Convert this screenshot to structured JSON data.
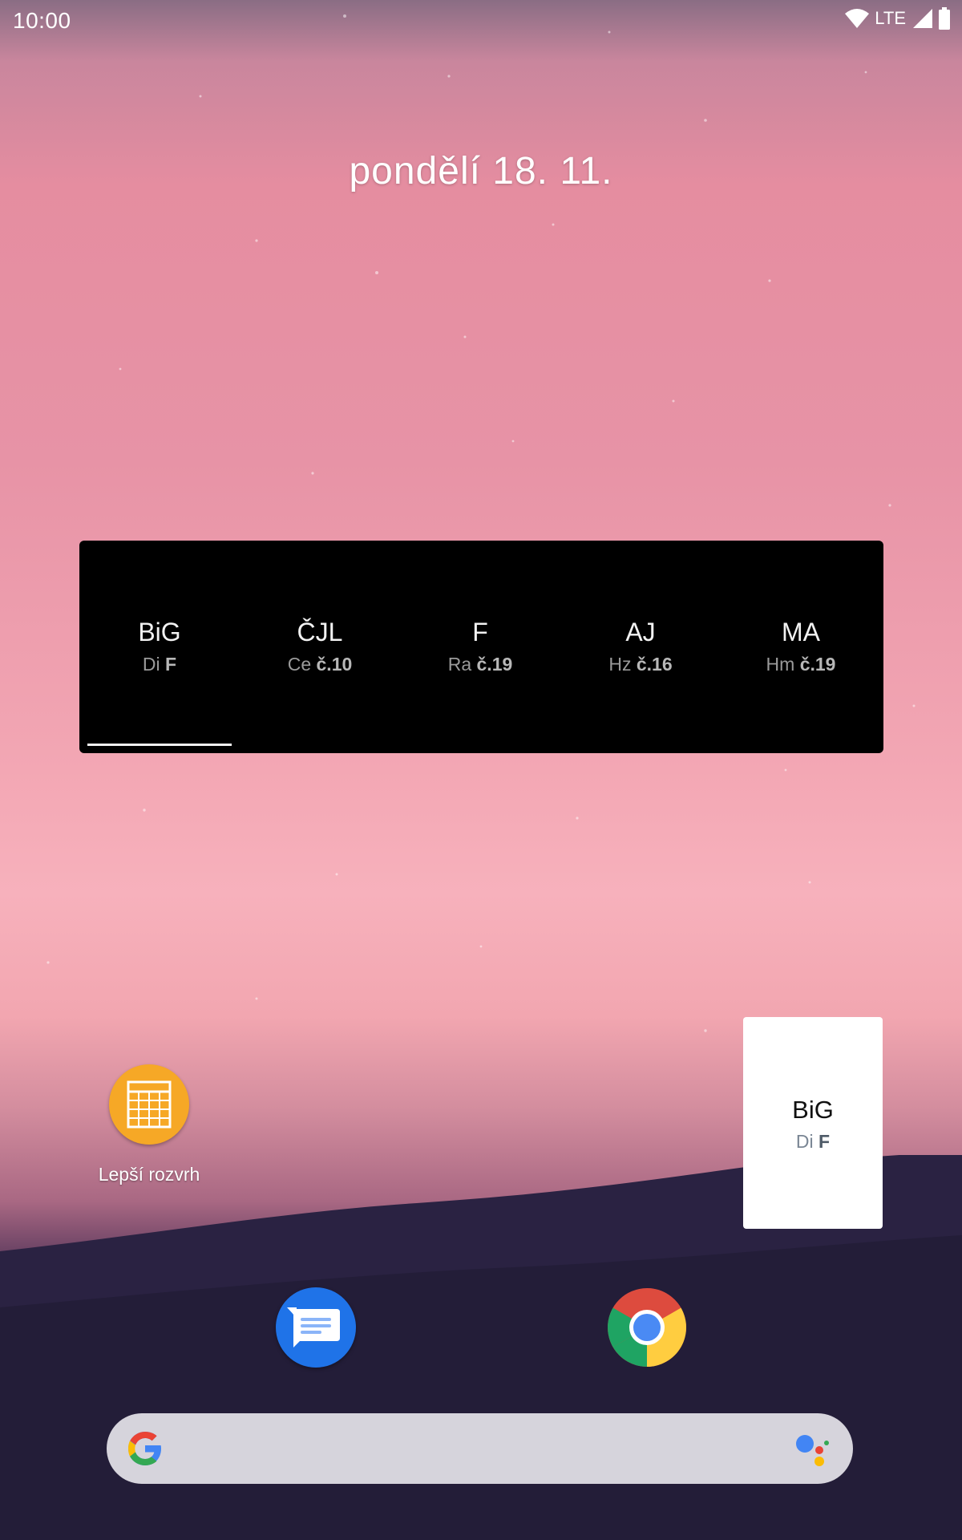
{
  "status_bar": {
    "time": "10:00",
    "network": "LTE",
    "icons": [
      "wifi-icon",
      "cell-signal-icon",
      "battery-icon"
    ]
  },
  "home": {
    "date": "pondělí 18. 11."
  },
  "timetable_widget": {
    "slots": [
      {
        "subject": "BiG",
        "teacher": "Di",
        "room": "F"
      },
      {
        "subject": "ČJL",
        "teacher": "Ce",
        "room": "č.10"
      },
      {
        "subject": "F",
        "teacher": "Ra",
        "room": "č.19"
      },
      {
        "subject": "AJ",
        "teacher": "Hz",
        "room": "č.16"
      },
      {
        "subject": "MA",
        "teacher": "Hm",
        "room": "č.19"
      }
    ],
    "selected_index": 0
  },
  "small_widget": {
    "subject": "BiG",
    "teacher": "Di",
    "room": "F"
  },
  "app_shortcut": {
    "label": "Lepší rozvrh",
    "color": "#f6a826"
  },
  "dock": {
    "apps": [
      "messages-icon",
      "chrome-icon"
    ]
  },
  "search_bar": {
    "icons": [
      "google-g-icon",
      "assistant-icon"
    ]
  }
}
